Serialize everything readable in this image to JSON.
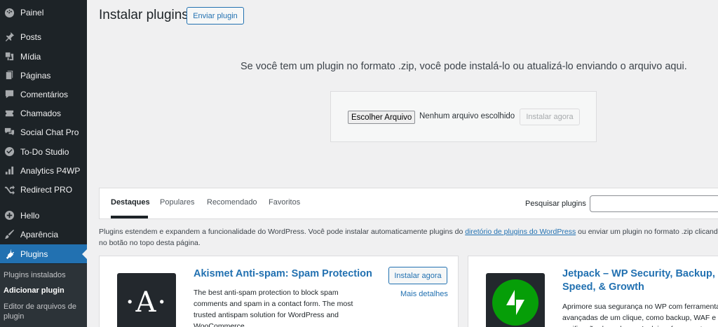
{
  "sidebar": {
    "items": [
      {
        "label": "Painel",
        "icon": "dashboard-icon"
      },
      {
        "label": "Posts",
        "icon": "pin-icon"
      },
      {
        "label": "Mídia",
        "icon": "media-icon"
      },
      {
        "label": "Páginas",
        "icon": "page-icon"
      },
      {
        "label": "Comentários",
        "icon": "comment-icon"
      },
      {
        "label": "Chamados",
        "icon": "ticket-icon"
      },
      {
        "label": "Social Chat Pro",
        "icon": "chat-icon"
      },
      {
        "label": "To-Do Studio",
        "icon": "check-icon"
      },
      {
        "label": "Analytics P4WP",
        "icon": "chart-icon"
      },
      {
        "label": "Redirect PRO",
        "icon": "shuffle-icon"
      },
      {
        "label": "Hello",
        "icon": "plus-circle-icon"
      },
      {
        "label": "Aparência",
        "icon": "brush-icon"
      },
      {
        "label": "Plugins",
        "icon": "plugin-icon"
      }
    ],
    "submenu": [
      "Plugins instalados",
      "Adicionar plugin",
      "Editor de arquivos de plugin"
    ],
    "active_color": "#2271b1"
  },
  "header": {
    "title": "Instalar plugins",
    "upload_button": "Enviar plugin"
  },
  "upload": {
    "help_text": "Se você tem um plugin no formato .zip, você pode instalá-lo ou atualizá-lo enviando o arquivo aqui.",
    "choose_file": "Escolher Arquivo",
    "no_file": "Nenhum arquivo escolhido",
    "install_now": "Instalar agora"
  },
  "filters": {
    "tabs": [
      "Destaques",
      "Populares",
      "Recomendado",
      "Favoritos"
    ],
    "current_tab": "Destaques",
    "search_label": "Pesquisar plugins",
    "search_value": ""
  },
  "intro": {
    "text_before": "Plugins estendem e expandem a funcionalidade do WordPress. Você pode instalar automaticamente plugins do ",
    "link": "diretório de plugins do WordPress",
    "text_after": " ou enviar um plugin no formato .zip clicando no botão no topo desta página."
  },
  "plugins": [
    {
      "name": "Akismet Anti-spam: Spam Protection",
      "description": "The best anti-spam protection to block spam comments and spam in a contact form. The most trusted antispam solution for WordPress and WooCommerce.",
      "install": "Instalar agora",
      "details": "Mais detalhes",
      "icon": "akismet-logo-icon"
    },
    {
      "name": "Jetpack – WP Security, Backup, Speed, & Growth",
      "description": "Aprimore sua segurança no WP com ferramentas avançadas de um clique, como backup, WAF e verificação de malware. Inclui as ferramentas",
      "icon": "jetpack-logo-icon"
    }
  ]
}
